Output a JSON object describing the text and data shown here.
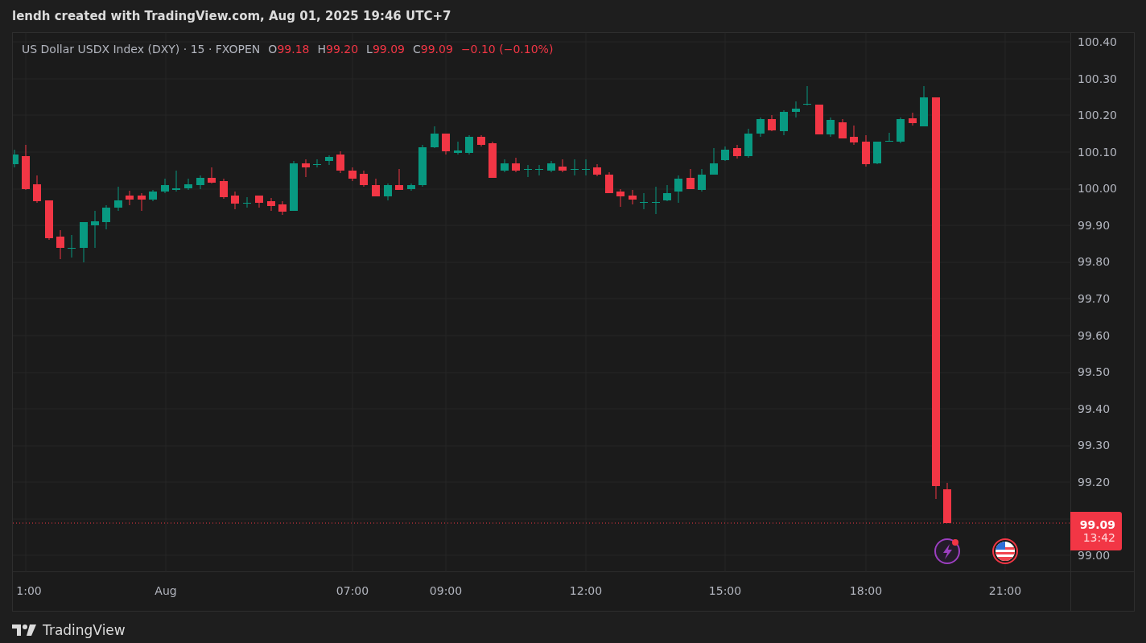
{
  "header": {
    "title": "lendh created with TradingView.com, Aug 01, 2025 19:46 UTC+7"
  },
  "legend": {
    "symbol": "US Dollar USDX Index (DXY) · 15 · FXOPEN",
    "ohlc": [
      {
        "label": "O",
        "value": "99.18"
      },
      {
        "label": "H",
        "value": "99.20"
      },
      {
        "label": "L",
        "value": "99.09"
      },
      {
        "label": "C",
        "value": "99.09"
      }
    ],
    "change": "−0.10 (−0.10%)"
  },
  "price_axis": {
    "labels": [
      "100.40",
      "100.30",
      "100.20",
      "100.10",
      "100.00",
      "99.90",
      "99.80",
      "99.70",
      "99.60",
      "99.50",
      "99.40",
      "99.30",
      "99.20",
      "99.00"
    ],
    "current_price": "99.09",
    "countdown": "13:42"
  },
  "time_axis": {
    "labels": [
      "1:00",
      "Aug",
      "07:00",
      "09:00",
      "12:00",
      "15:00",
      "18:00",
      "21:00"
    ]
  },
  "footer": {
    "brand": "TradingView"
  }
}
